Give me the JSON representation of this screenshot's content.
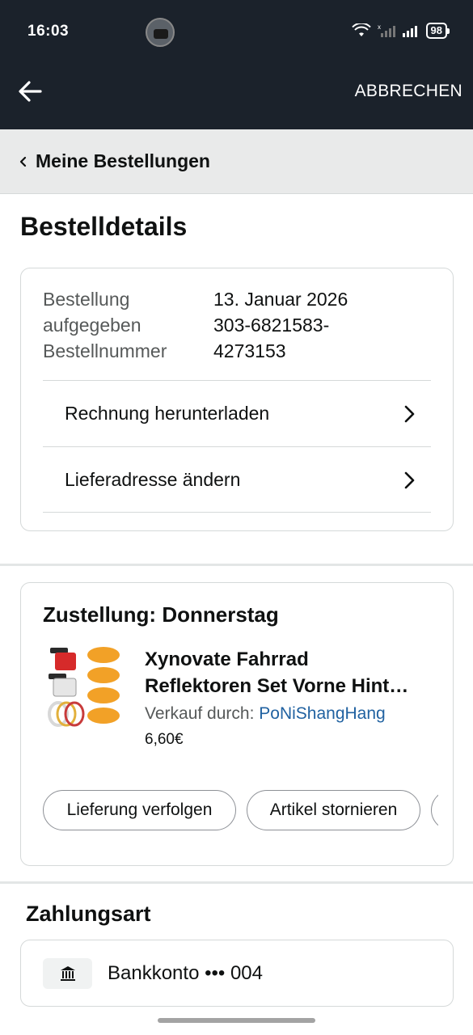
{
  "status_bar": {
    "time": "16:03",
    "battery": "98"
  },
  "nav": {
    "cancel_label": "ABBRECHEN"
  },
  "breadcrumb": {
    "label": "Meine Bestellungen"
  },
  "page": {
    "title": "Bestelldetails"
  },
  "order_details": {
    "label_line1": "Bestellung",
    "label_line2": "aufgegeben",
    "label_line3": "Bestellnummer",
    "value_date": "13. Januar 2026",
    "value_number_line1": "303-6821583-",
    "value_number_line2": "4273153",
    "actions": [
      {
        "label": "Rechnung herunterladen"
      },
      {
        "label": "Lieferadresse ändern"
      }
    ]
  },
  "delivery": {
    "title": "Zustellung: Donnerstag",
    "product": {
      "name_line1": "Xynovate Fahrrad",
      "name_line2": "Reflektoren Set Vorne Hint…",
      "seller_prefix": "Verkauf durch:",
      "seller_name": "PoNiShangHang",
      "price": "6,60€"
    },
    "buttons": [
      {
        "label": "Lieferung verfolgen"
      },
      {
        "label": "Artikel stornieren"
      }
    ]
  },
  "payment": {
    "title": "Zahlungsart",
    "method": "Bankkonto ••• 004",
    "icon": "🏛"
  },
  "colors": {
    "header_bg": "#1b222b",
    "link": "#2162a1",
    "breadcrumb_bg": "#e9eaea"
  }
}
